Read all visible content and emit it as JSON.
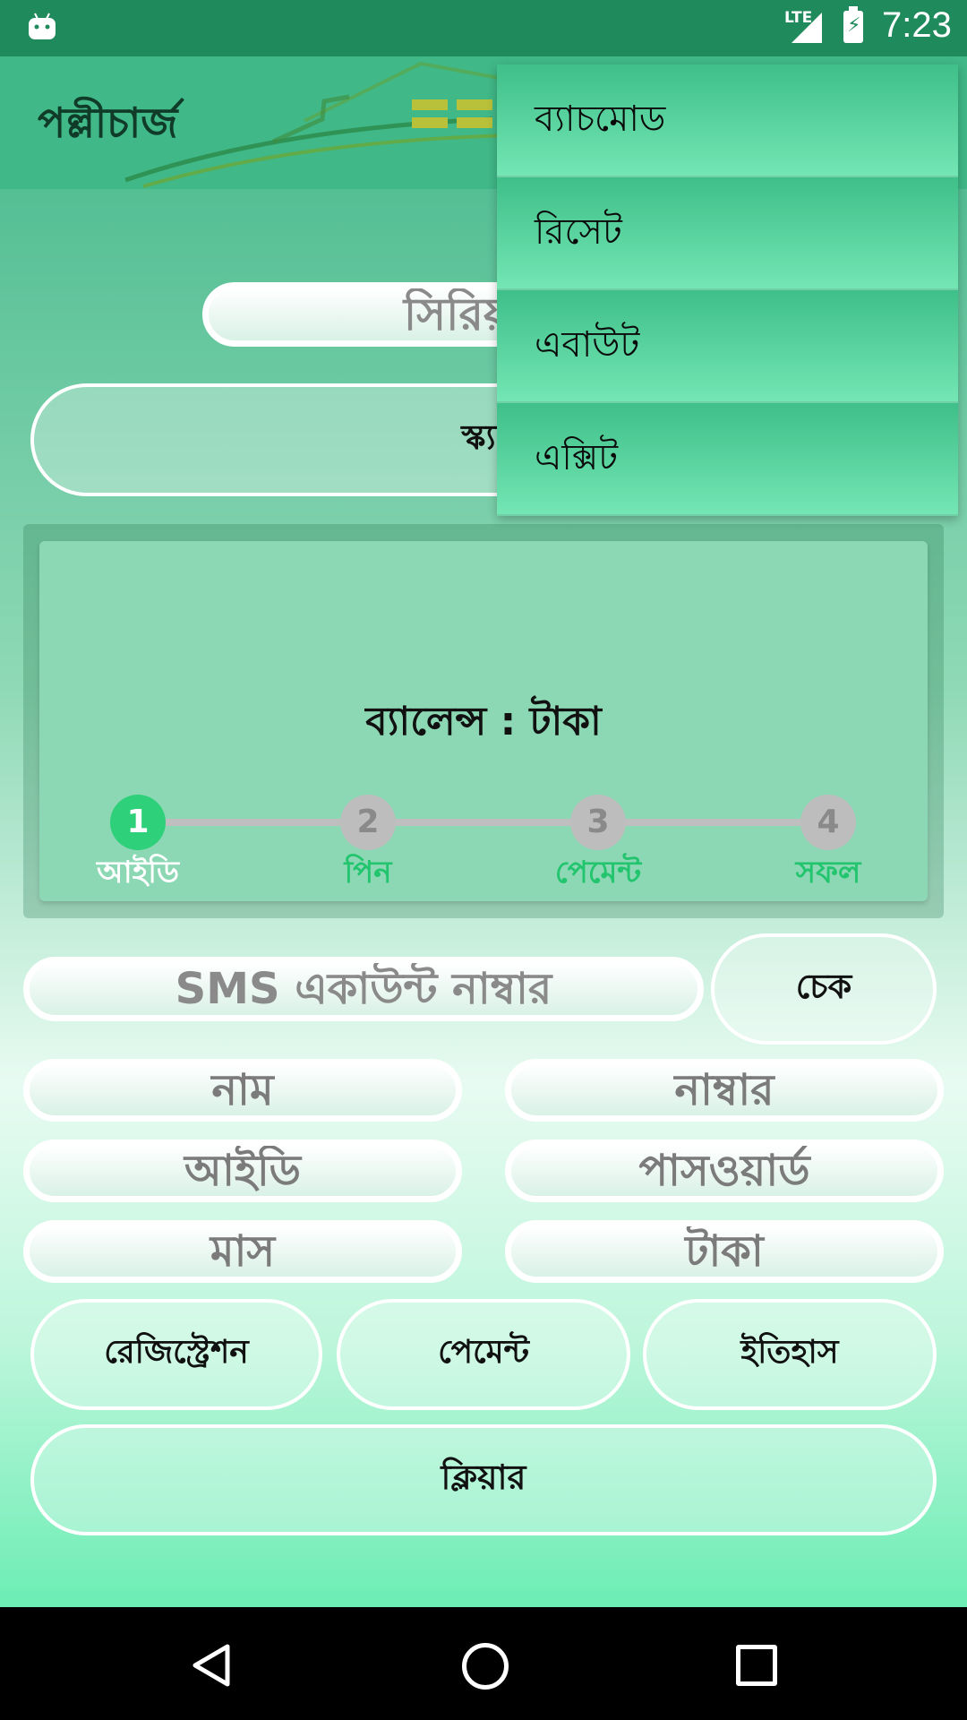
{
  "status_bar": {
    "network": "LTE",
    "time": "7:23"
  },
  "app_bar": {
    "title": "পল্লীচার্জ"
  },
  "serial_field": {
    "text": "সিরিয়াল"
  },
  "scan_button": {
    "label": "স্ক্যা"
  },
  "balance": {
    "label": "ব্যালেন্স :  টাকা"
  },
  "stepper": {
    "active_step": 1,
    "steps": [
      {
        "number": "1",
        "label": "আইডি"
      },
      {
        "number": "2",
        "label": "পিন"
      },
      {
        "number": "3",
        "label": "পেমেন্ট"
      },
      {
        "number": "4",
        "label": "সফল"
      }
    ]
  },
  "sms_account": {
    "placeholder": "SMS একাউন্ট নাম্বার",
    "check_label": "চেক"
  },
  "fields": {
    "name": "নাম",
    "number": "নাম্বার",
    "id": "আইডি",
    "password": "পাসওয়ার্ড",
    "month": "মাস",
    "amount": "টাকা"
  },
  "buttons": {
    "registration": "রেজিস্ট্রেশন",
    "payment": "পেমেন্ট",
    "history": "ইতিহাস",
    "clear": "ক্লিয়ার"
  },
  "overflow_menu": {
    "items": [
      "ব্যাচমোড",
      "রিসেট",
      "এবাউট",
      "এক্সিট"
    ]
  },
  "colors": {
    "accent": "#40b887",
    "step_active": "#2fd07a",
    "step_inactive": "#bdbdbd"
  }
}
